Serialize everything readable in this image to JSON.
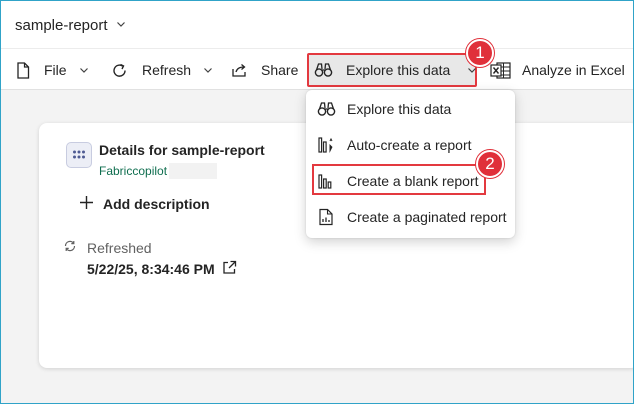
{
  "header": {
    "report_name": "sample-report"
  },
  "toolbar": {
    "file_label": "File",
    "refresh_label": "Refresh",
    "share_label": "Share",
    "explore_label": "Explore this data",
    "analyze_label": "Analyze in Excel"
  },
  "menu": {
    "items": [
      {
        "label": "Explore this data",
        "icon": "binoculars-icon"
      },
      {
        "label": "Auto-create a report",
        "icon": "auto-create-report-icon"
      },
      {
        "label": "Create a blank report",
        "icon": "blank-report-icon"
      },
      {
        "label": "Create a paginated report",
        "icon": "paginated-report-icon"
      }
    ]
  },
  "callouts": {
    "first": "1",
    "second": "2",
    "color": "#e0303a"
  },
  "details": {
    "title": "Details for sample-report",
    "workspace": "Fabriccopilot",
    "add_description_label": "Add description",
    "refreshed_label": "Refreshed",
    "refreshed_value": "5/22/25, 8:34:46 PM"
  },
  "colors": {
    "highlight_border": "#e3393f",
    "workspace_link": "#0f6e4f"
  }
}
